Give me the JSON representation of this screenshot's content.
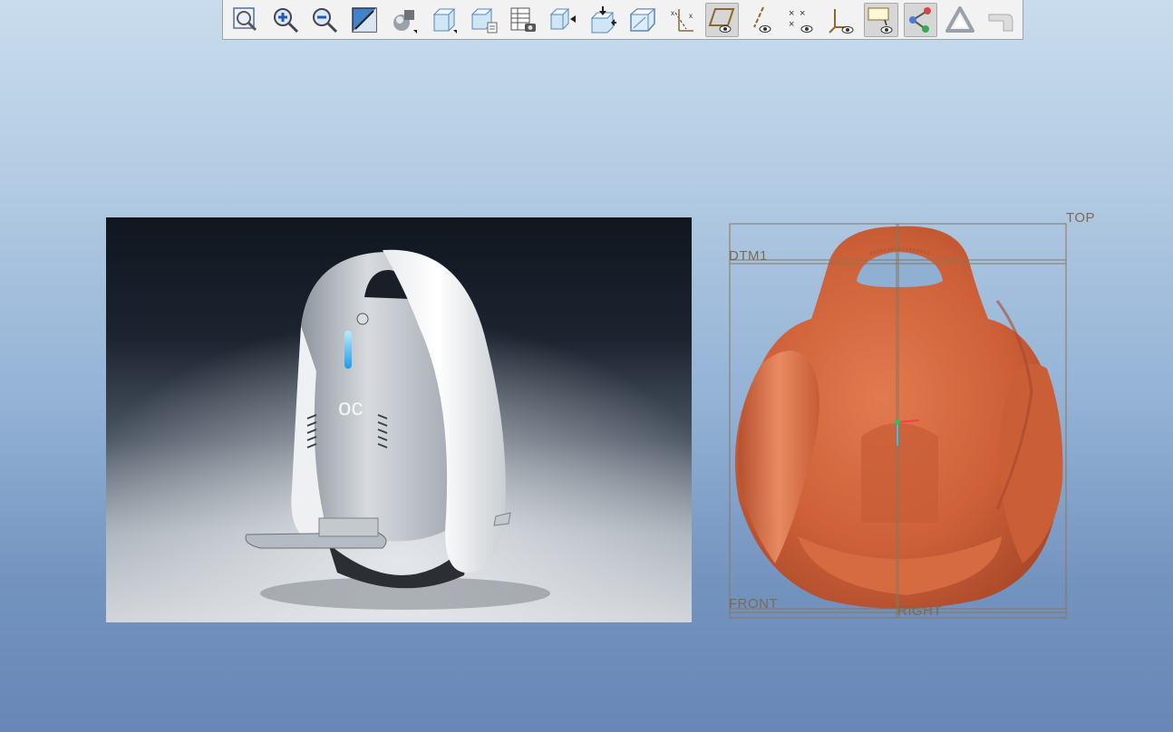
{
  "toolbar": {
    "tools": [
      {
        "name": "refit-icon",
        "title": "Refit"
      },
      {
        "name": "zoom-in-icon",
        "title": "Zoom In"
      },
      {
        "name": "zoom-out-icon",
        "title": "Zoom Out"
      },
      {
        "name": "repaint-icon",
        "title": "Repaint"
      },
      {
        "name": "display-style-icon",
        "title": "Display Style"
      },
      {
        "name": "saved-views-icon",
        "title": "Saved Orientations"
      },
      {
        "name": "view-manager-icon",
        "title": "View Manager"
      },
      {
        "name": "layers-icon",
        "title": "Layers"
      },
      {
        "name": "reorient-icon",
        "title": "Reorient"
      },
      {
        "name": "annotation-display-icon",
        "title": "Annotation Display"
      },
      {
        "name": "appearance-icon",
        "title": "Appearance"
      },
      {
        "name": "coordinate-display-icon",
        "title": "Coordinate Display"
      },
      {
        "name": "plane-display-icon",
        "title": "Plane Display",
        "active": true
      },
      {
        "name": "axis-display-icon",
        "title": "Axis Display"
      },
      {
        "name": "point-display-icon",
        "title": "Point Display"
      },
      {
        "name": "csys-display-icon",
        "title": "Csys Display"
      },
      {
        "name": "annotation-toggle-icon",
        "title": "Annotation Display",
        "active": true
      },
      {
        "name": "spin-center-icon",
        "title": "Spin Center",
        "active": true
      },
      {
        "name": "perspective-icon",
        "title": "Perspective"
      },
      {
        "name": "sketch-display-icon",
        "title": "Sketch"
      }
    ]
  },
  "datums": {
    "top": "TOP",
    "dtm1": "DTM1",
    "front": "FRONT",
    "right": "RIGHT"
  },
  "colors": {
    "model": "#d0643a",
    "datum_lines": "#8a7658",
    "csys_green": "#22c55e",
    "csys_red": "#ef4444",
    "csys_cyan": "#38bdf8"
  }
}
